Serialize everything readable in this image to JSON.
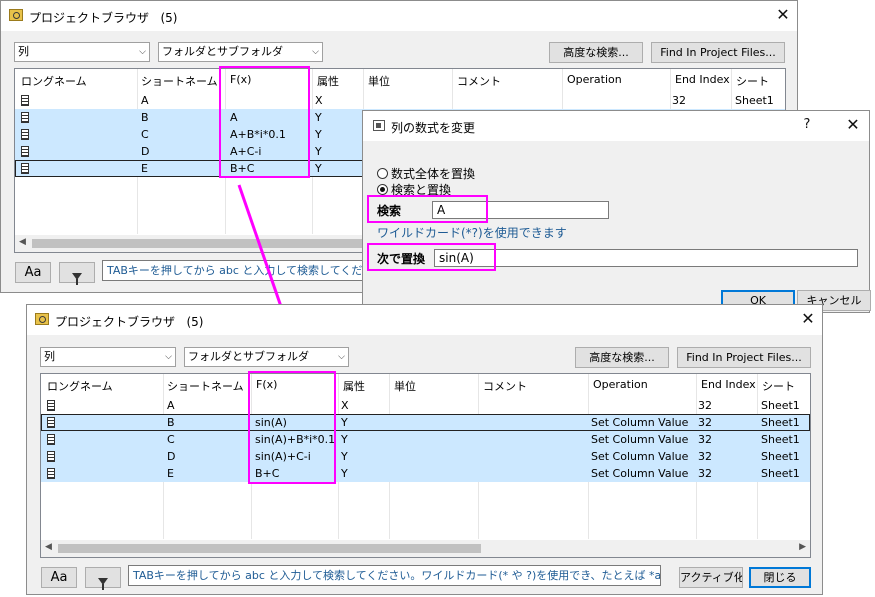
{
  "pb1": {
    "title": "プロジェクトブラウザ",
    "count": "(5)",
    "combo_type": "列",
    "combo_scope": "フォルダとサブフォルダ",
    "advanced_label": "高度な検索...",
    "find_label": "Find In Project Files...",
    "columns": [
      "ロングネーム",
      "ショートネーム",
      "F(x)",
      "属性",
      "単位",
      "コメント",
      "Operation",
      "End Index",
      "シート"
    ],
    "rows": [
      {
        "short": "A",
        "fx": "",
        "attr": "X",
        "op": "",
        "end": "32",
        "sheet": "Sheet1"
      },
      {
        "short": "B",
        "fx": "A",
        "attr": "Y",
        "op": "",
        "end": "",
        "sheet": ""
      },
      {
        "short": "C",
        "fx": "A+B*i*0.1",
        "attr": "Y",
        "op": "",
        "end": "",
        "sheet": ""
      },
      {
        "short": "D",
        "fx": "A+C-i",
        "attr": "Y",
        "op": "",
        "end": "",
        "sheet": ""
      },
      {
        "short": "E",
        "fx": "B+C",
        "attr": "Y",
        "op": "",
        "end": "",
        "sheet": ""
      }
    ],
    "aa_label": "Aa",
    "search_placeholder": "TABキーを押してから abc と入力して検索してくださ"
  },
  "dialog": {
    "title": "列の数式を変更",
    "help": "?",
    "option1": "数式全体を置換",
    "option2": "検索と置換",
    "search_label": "検索",
    "search_value": "A",
    "wildcard_note": "ワイルドカード(*?)を使用できます",
    "replace_label": "次で置換",
    "replace_value": "sin(A)",
    "ok_label": "OK",
    "cancel_label": "キャンセル"
  },
  "pb2": {
    "title": "プロジェクトブラウザ",
    "count": "(5)",
    "combo_type": "列",
    "combo_scope": "フォルダとサブフォルダ",
    "advanced_label": "高度な検索...",
    "find_label": "Find In Project Files...",
    "columns": [
      "ロングネーム",
      "ショートネーム",
      "F(x)",
      "属性",
      "単位",
      "コメント",
      "Operation",
      "End Index",
      "シート"
    ],
    "rows": [
      {
        "short": "A",
        "fx": "",
        "attr": "X",
        "op": "",
        "end": "32",
        "sheet": "Sheet1"
      },
      {
        "short": "B",
        "fx": "sin(A)",
        "attr": "Y",
        "op": "Set Column Value",
        "end": "32",
        "sheet": "Sheet1"
      },
      {
        "short": "C",
        "fx": "sin(A)+B*i*0.1",
        "attr": "Y",
        "op": "Set Column Value",
        "end": "32",
        "sheet": "Sheet1"
      },
      {
        "short": "D",
        "fx": "sin(A)+C-i",
        "attr": "Y",
        "op": "Set Column Value",
        "end": "32",
        "sheet": "Sheet1"
      },
      {
        "short": "E",
        "fx": "B+C",
        "attr": "Y",
        "op": "Set Column Value",
        "end": "32",
        "sheet": "Sheet1"
      }
    ],
    "aa_label": "Aa",
    "search_placeholder": "TABキーを押してから abc と入力して検索してください。ワイルドカード(* や ?)を使用でき、たとえば *abc",
    "activate_label": "アクティブ化",
    "close_label": "閉じる"
  },
  "colors": {
    "highlight": "#ff00ff",
    "selection": "#cce8ff",
    "focus_blue": "#0078d7",
    "link_blue": "#1e5b94"
  }
}
